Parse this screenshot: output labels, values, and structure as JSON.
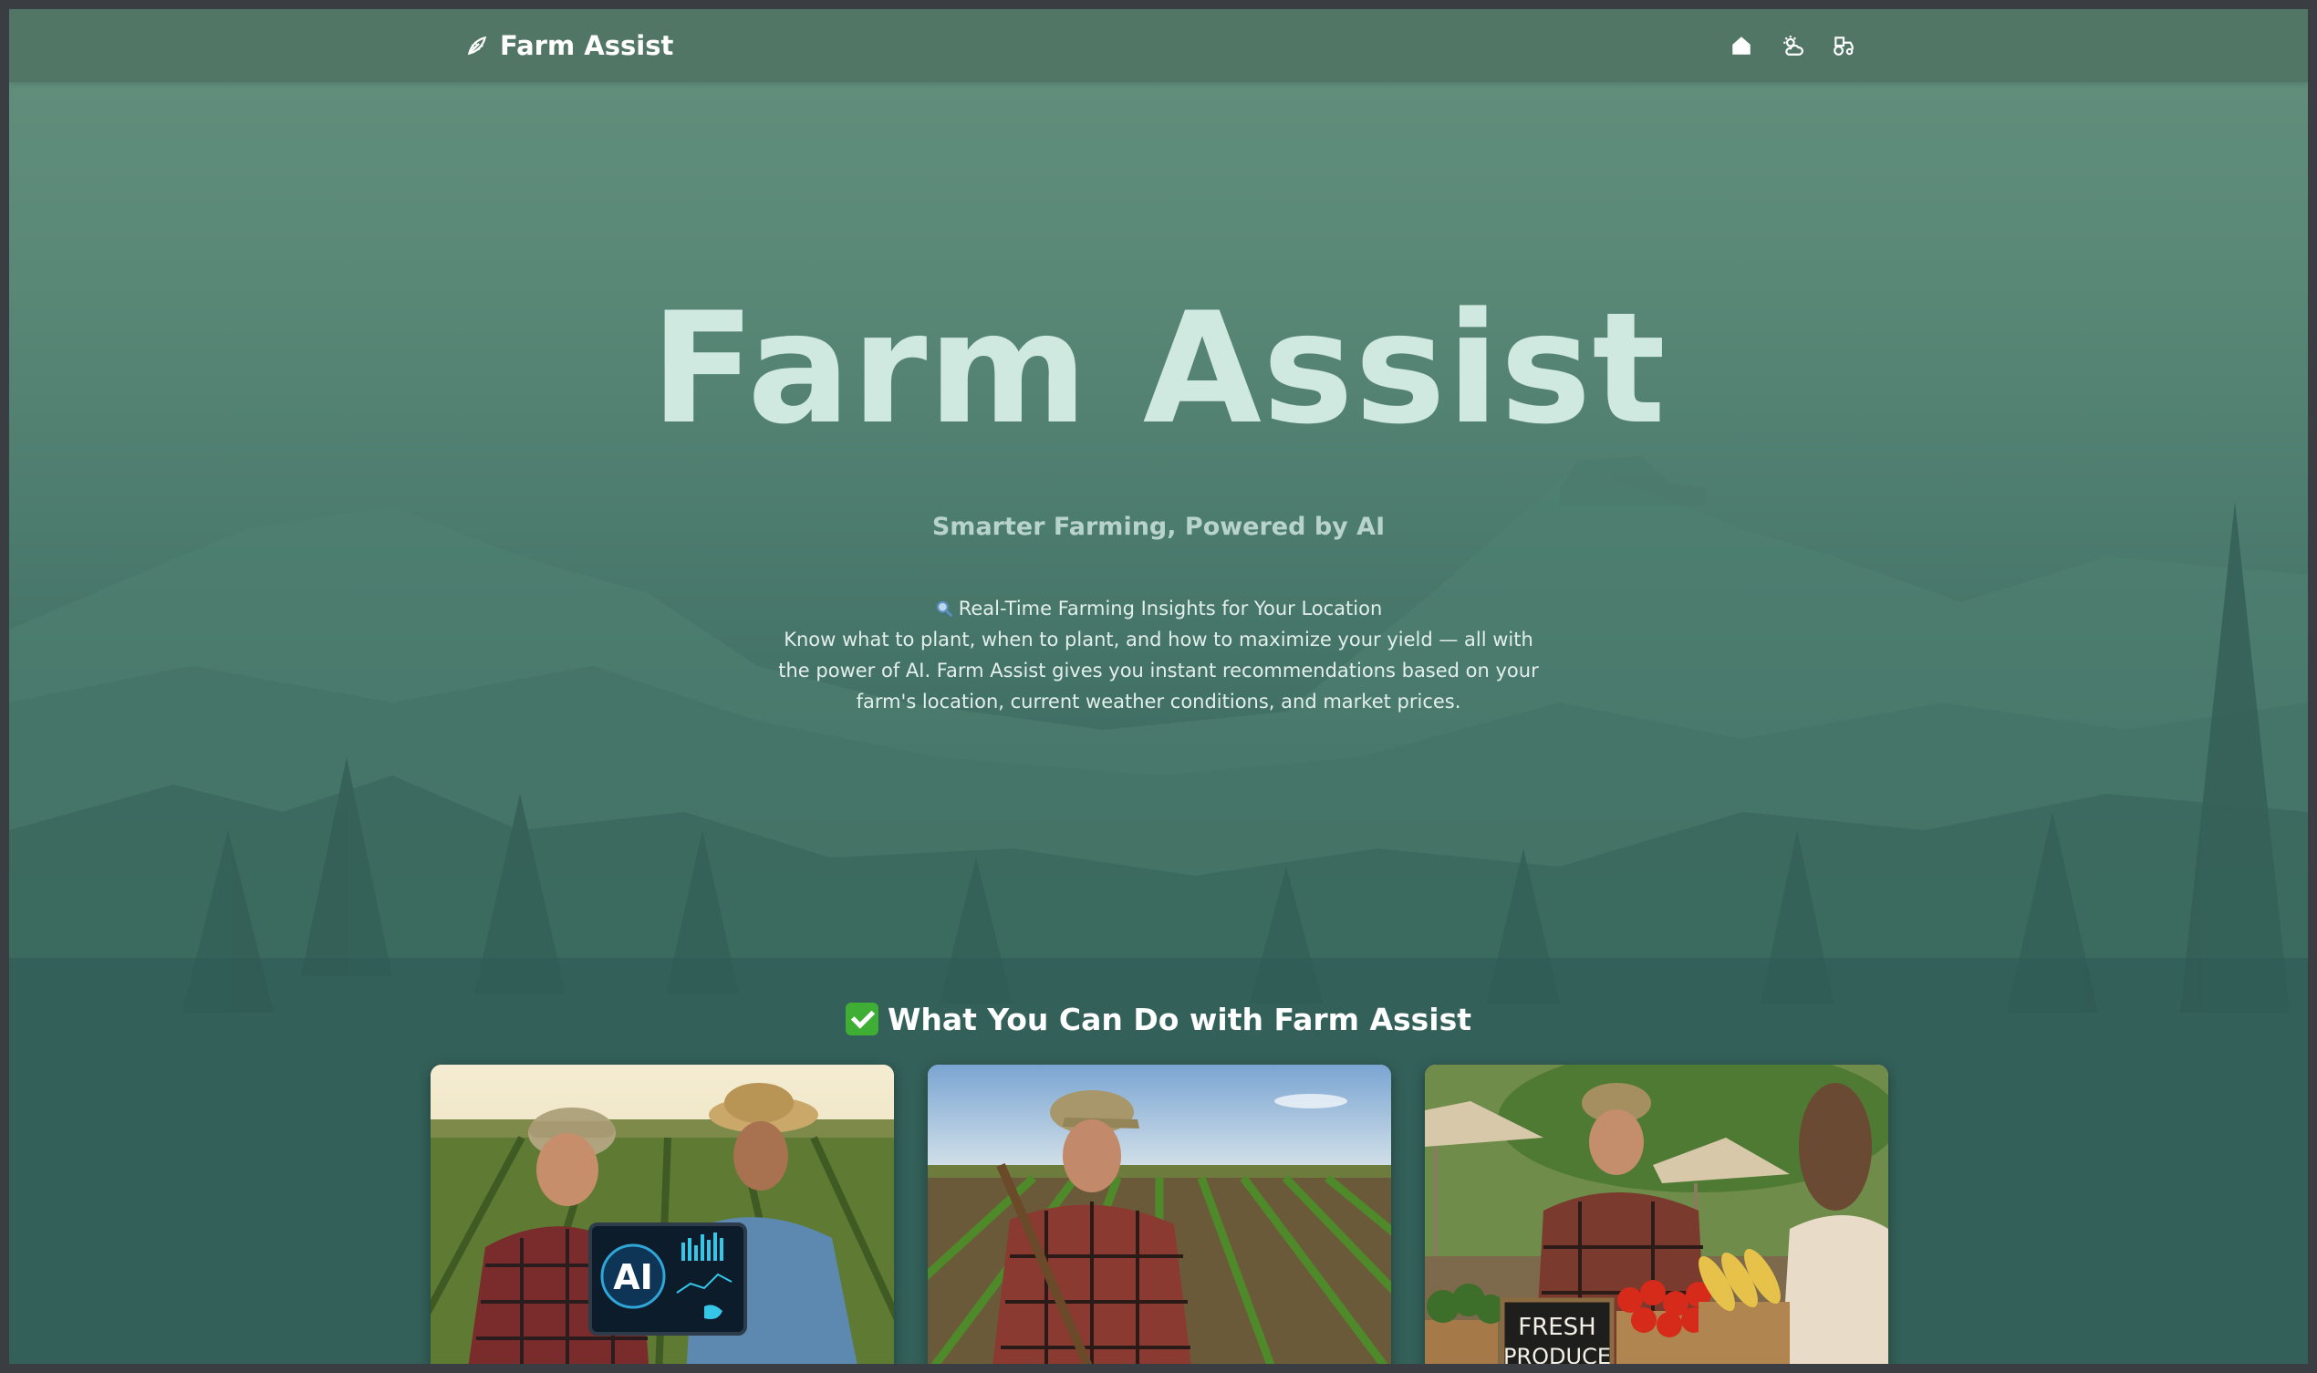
{
  "navbar": {
    "brand_icon": "seedling-icon",
    "brand": "Farm Assist",
    "icons": [
      "home-icon",
      "weather-icon",
      "tractor-icon"
    ]
  },
  "hero": {
    "title": "Farm Assist",
    "subtitle": "Smarter Farming, Powered by AI",
    "headline_icon": "magnifier-icon",
    "headline": "Real-Time Farming Insights for Your Location",
    "description": "Know what to plant, when to plant, and how to maximize your yield — all with the power of AI. Farm Assist gives you instant recommendations based on your farm's location, current weather conditions, and market prices."
  },
  "features": {
    "title_icon": "checkmark-icon",
    "title": "What You Can Do with Farm Assist",
    "cards": [
      {
        "image": "farmers-with-ai-tablet",
        "tablet_label": "AI"
      },
      {
        "image": "farmer-in-crop-field"
      },
      {
        "image": "farmer-at-market-stall",
        "sign_line1": "FRESH",
        "sign_line2": "PRODUCE"
      }
    ]
  },
  "colors": {
    "navbar": "#527665",
    "title": "#cfe8e0",
    "accent_check": "#3fae35"
  }
}
